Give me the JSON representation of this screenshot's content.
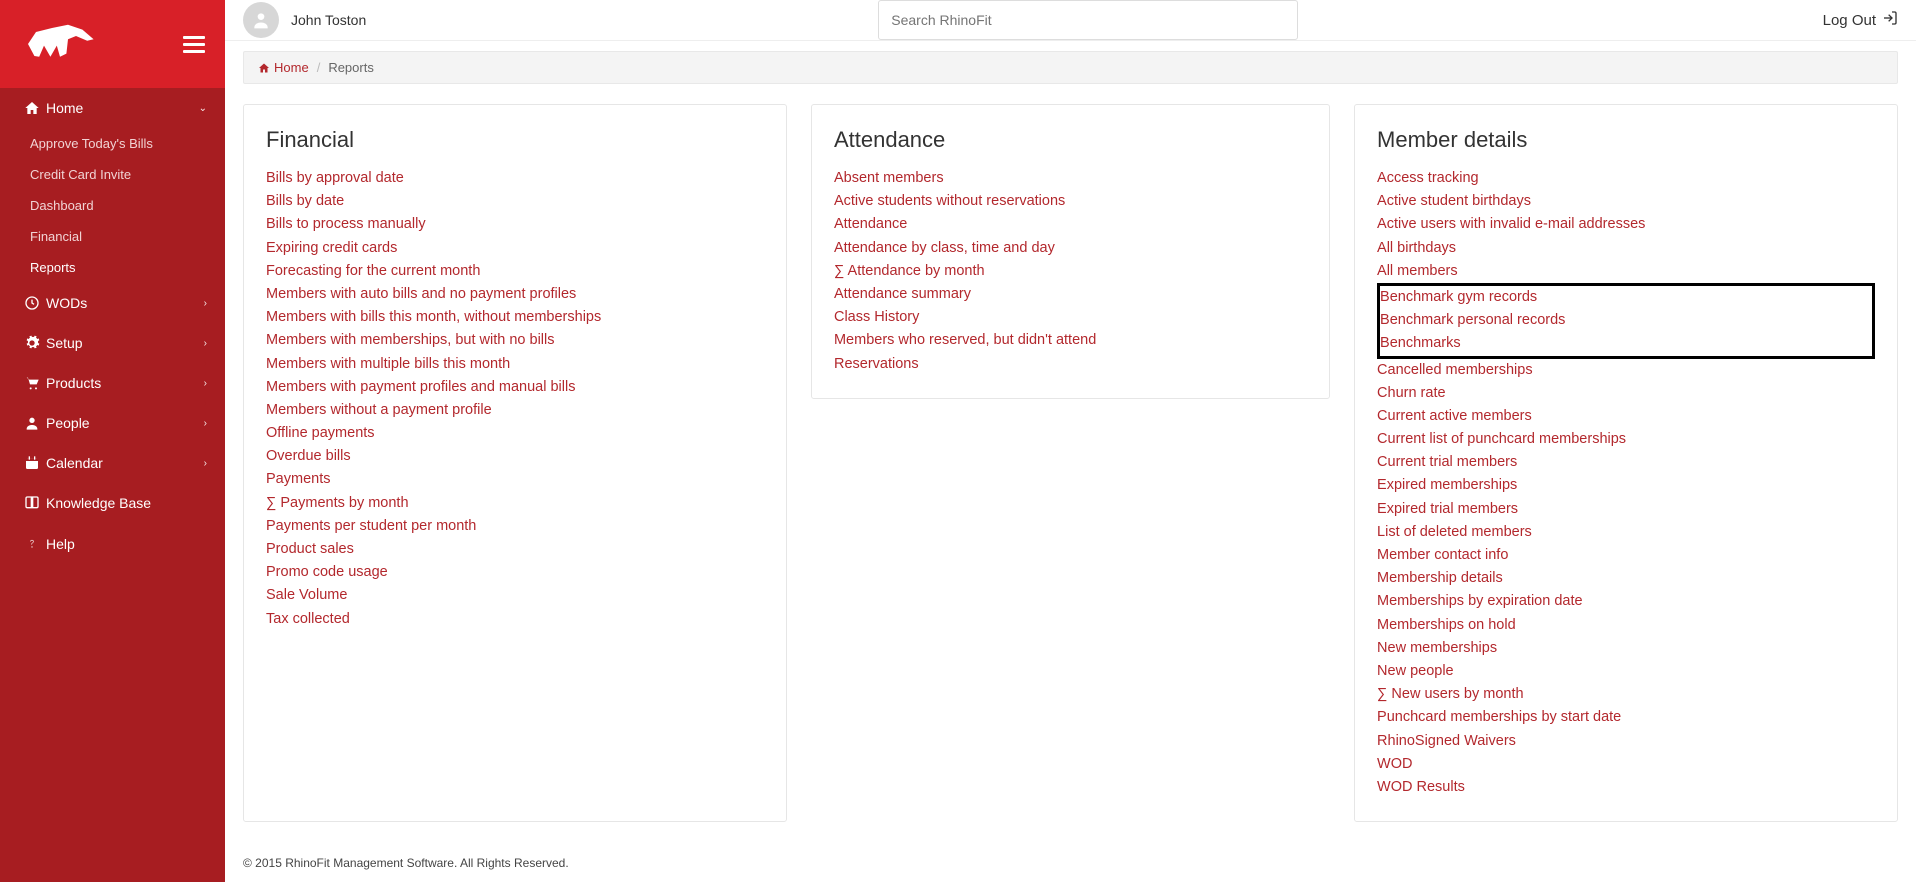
{
  "header": {
    "user_name": "John Toston",
    "search_placeholder": "Search RhinoFit",
    "logout_label": "Log Out"
  },
  "breadcrumb": {
    "home": "Home",
    "current": "Reports"
  },
  "sidebar": {
    "home": {
      "label": "Home"
    },
    "home_sub": [
      "Approve Today's Bills",
      "Credit Card Invite",
      "Dashboard",
      "Financial",
      "Reports"
    ],
    "items": [
      {
        "label": "WODs",
        "icon": "clock"
      },
      {
        "label": "Setup",
        "icon": "gear"
      },
      {
        "label": "Products",
        "icon": "cart"
      },
      {
        "label": "People",
        "icon": "person"
      },
      {
        "label": "Calendar",
        "icon": "calendar"
      },
      {
        "label": "Knowledge Base",
        "icon": "book",
        "no_chevron": true
      },
      {
        "label": "Help",
        "icon": "help",
        "no_chevron": true
      }
    ]
  },
  "panels": {
    "financial": {
      "title": "Financial",
      "links": [
        "Bills by approval date",
        "Bills by date",
        "Bills to process manually",
        "Expiring credit cards",
        "Forecasting for the current month",
        "Members with auto bills and no payment profiles",
        "Members with bills this month, without memberships",
        "Members with memberships, but with no bills",
        "Members with multiple bills this month",
        "Members with payment profiles and manual bills",
        "Members without a payment profile",
        "Offline payments",
        "Overdue bills",
        "Payments",
        "∑ Payments by month",
        "Payments per student per month",
        "Product sales",
        "Promo code usage",
        "Sale Volume",
        "Tax collected"
      ]
    },
    "attendance": {
      "title": "Attendance",
      "links": [
        "Absent members",
        "Active students without reservations",
        "Attendance",
        "Attendance by class, time and day",
        "∑ Attendance by month",
        "Attendance summary",
        "Class History",
        "Members who reserved, but didn't attend",
        "Reservations"
      ]
    },
    "member_details": {
      "title": "Member details",
      "links": [
        "Access tracking",
        "Active student birthdays",
        "Active users with invalid e-mail addresses",
        "All birthdays",
        "All members",
        "Benchmark gym records",
        "Benchmark personal records",
        "Benchmarks",
        "Cancelled memberships",
        "Churn rate",
        "Current active members",
        "Current list of punchcard memberships",
        "Current trial members",
        "Expired memberships",
        "Expired trial members",
        "List of deleted members",
        "Member contact info",
        "Membership details",
        "Memberships by expiration date",
        "Memberships on hold",
        "New memberships",
        "New people",
        "∑ New users by month",
        "Punchcard memberships by start date",
        "RhinoSigned Waivers",
        "WOD",
        "WOD Results"
      ],
      "highlighted": [
        5,
        6,
        7
      ]
    }
  },
  "footer": {
    "text": "© 2015 RhinoFit Management Software. All Rights Reserved."
  }
}
